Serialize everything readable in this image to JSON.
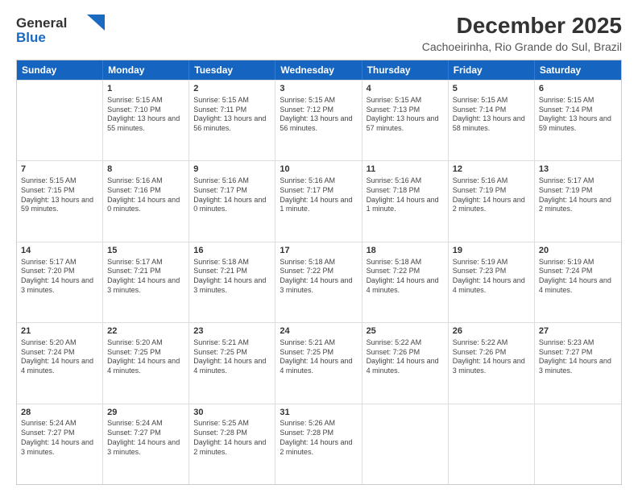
{
  "logo": {
    "line1": "General",
    "line2": "Blue"
  },
  "title": "December 2025",
  "subtitle": "Cachoeirinha, Rio Grande do Sul, Brazil",
  "days_of_week": [
    "Sunday",
    "Monday",
    "Tuesday",
    "Wednesday",
    "Thursday",
    "Friday",
    "Saturday"
  ],
  "weeks": [
    [
      {
        "day": "",
        "sunrise": "",
        "sunset": "",
        "daylight": ""
      },
      {
        "day": "1",
        "sunrise": "Sunrise: 5:15 AM",
        "sunset": "Sunset: 7:10 PM",
        "daylight": "Daylight: 13 hours and 55 minutes."
      },
      {
        "day": "2",
        "sunrise": "Sunrise: 5:15 AM",
        "sunset": "Sunset: 7:11 PM",
        "daylight": "Daylight: 13 hours and 56 minutes."
      },
      {
        "day": "3",
        "sunrise": "Sunrise: 5:15 AM",
        "sunset": "Sunset: 7:12 PM",
        "daylight": "Daylight: 13 hours and 56 minutes."
      },
      {
        "day": "4",
        "sunrise": "Sunrise: 5:15 AM",
        "sunset": "Sunset: 7:13 PM",
        "daylight": "Daylight: 13 hours and 57 minutes."
      },
      {
        "day": "5",
        "sunrise": "Sunrise: 5:15 AM",
        "sunset": "Sunset: 7:14 PM",
        "daylight": "Daylight: 13 hours and 58 minutes."
      },
      {
        "day": "6",
        "sunrise": "Sunrise: 5:15 AM",
        "sunset": "Sunset: 7:14 PM",
        "daylight": "Daylight: 13 hours and 59 minutes."
      }
    ],
    [
      {
        "day": "7",
        "sunrise": "Sunrise: 5:15 AM",
        "sunset": "Sunset: 7:15 PM",
        "daylight": "Daylight: 13 hours and 59 minutes."
      },
      {
        "day": "8",
        "sunrise": "Sunrise: 5:16 AM",
        "sunset": "Sunset: 7:16 PM",
        "daylight": "Daylight: 14 hours and 0 minutes."
      },
      {
        "day": "9",
        "sunrise": "Sunrise: 5:16 AM",
        "sunset": "Sunset: 7:17 PM",
        "daylight": "Daylight: 14 hours and 0 minutes."
      },
      {
        "day": "10",
        "sunrise": "Sunrise: 5:16 AM",
        "sunset": "Sunset: 7:17 PM",
        "daylight": "Daylight: 14 hours and 1 minute."
      },
      {
        "day": "11",
        "sunrise": "Sunrise: 5:16 AM",
        "sunset": "Sunset: 7:18 PM",
        "daylight": "Daylight: 14 hours and 1 minute."
      },
      {
        "day": "12",
        "sunrise": "Sunrise: 5:16 AM",
        "sunset": "Sunset: 7:19 PM",
        "daylight": "Daylight: 14 hours and 2 minutes."
      },
      {
        "day": "13",
        "sunrise": "Sunrise: 5:17 AM",
        "sunset": "Sunset: 7:19 PM",
        "daylight": "Daylight: 14 hours and 2 minutes."
      }
    ],
    [
      {
        "day": "14",
        "sunrise": "Sunrise: 5:17 AM",
        "sunset": "Sunset: 7:20 PM",
        "daylight": "Daylight: 14 hours and 3 minutes."
      },
      {
        "day": "15",
        "sunrise": "Sunrise: 5:17 AM",
        "sunset": "Sunset: 7:21 PM",
        "daylight": "Daylight: 14 hours and 3 minutes."
      },
      {
        "day": "16",
        "sunrise": "Sunrise: 5:18 AM",
        "sunset": "Sunset: 7:21 PM",
        "daylight": "Daylight: 14 hours and 3 minutes."
      },
      {
        "day": "17",
        "sunrise": "Sunrise: 5:18 AM",
        "sunset": "Sunset: 7:22 PM",
        "daylight": "Daylight: 14 hours and 3 minutes."
      },
      {
        "day": "18",
        "sunrise": "Sunrise: 5:18 AM",
        "sunset": "Sunset: 7:22 PM",
        "daylight": "Daylight: 14 hours and 4 minutes."
      },
      {
        "day": "19",
        "sunrise": "Sunrise: 5:19 AM",
        "sunset": "Sunset: 7:23 PM",
        "daylight": "Daylight: 14 hours and 4 minutes."
      },
      {
        "day": "20",
        "sunrise": "Sunrise: 5:19 AM",
        "sunset": "Sunset: 7:24 PM",
        "daylight": "Daylight: 14 hours and 4 minutes."
      }
    ],
    [
      {
        "day": "21",
        "sunrise": "Sunrise: 5:20 AM",
        "sunset": "Sunset: 7:24 PM",
        "daylight": "Daylight: 14 hours and 4 minutes."
      },
      {
        "day": "22",
        "sunrise": "Sunrise: 5:20 AM",
        "sunset": "Sunset: 7:25 PM",
        "daylight": "Daylight: 14 hours and 4 minutes."
      },
      {
        "day": "23",
        "sunrise": "Sunrise: 5:21 AM",
        "sunset": "Sunset: 7:25 PM",
        "daylight": "Daylight: 14 hours and 4 minutes."
      },
      {
        "day": "24",
        "sunrise": "Sunrise: 5:21 AM",
        "sunset": "Sunset: 7:25 PM",
        "daylight": "Daylight: 14 hours and 4 minutes."
      },
      {
        "day": "25",
        "sunrise": "Sunrise: 5:22 AM",
        "sunset": "Sunset: 7:26 PM",
        "daylight": "Daylight: 14 hours and 4 minutes."
      },
      {
        "day": "26",
        "sunrise": "Sunrise: 5:22 AM",
        "sunset": "Sunset: 7:26 PM",
        "daylight": "Daylight: 14 hours and 3 minutes."
      },
      {
        "day": "27",
        "sunrise": "Sunrise: 5:23 AM",
        "sunset": "Sunset: 7:27 PM",
        "daylight": "Daylight: 14 hours and 3 minutes."
      }
    ],
    [
      {
        "day": "28",
        "sunrise": "Sunrise: 5:24 AM",
        "sunset": "Sunset: 7:27 PM",
        "daylight": "Daylight: 14 hours and 3 minutes."
      },
      {
        "day": "29",
        "sunrise": "Sunrise: 5:24 AM",
        "sunset": "Sunset: 7:27 PM",
        "daylight": "Daylight: 14 hours and 3 minutes."
      },
      {
        "day": "30",
        "sunrise": "Sunrise: 5:25 AM",
        "sunset": "Sunset: 7:28 PM",
        "daylight": "Daylight: 14 hours and 2 minutes."
      },
      {
        "day": "31",
        "sunrise": "Sunrise: 5:26 AM",
        "sunset": "Sunset: 7:28 PM",
        "daylight": "Daylight: 14 hours and 2 minutes."
      },
      {
        "day": "",
        "sunrise": "",
        "sunset": "",
        "daylight": ""
      },
      {
        "day": "",
        "sunrise": "",
        "sunset": "",
        "daylight": ""
      },
      {
        "day": "",
        "sunrise": "",
        "sunset": "",
        "daylight": ""
      }
    ]
  ]
}
